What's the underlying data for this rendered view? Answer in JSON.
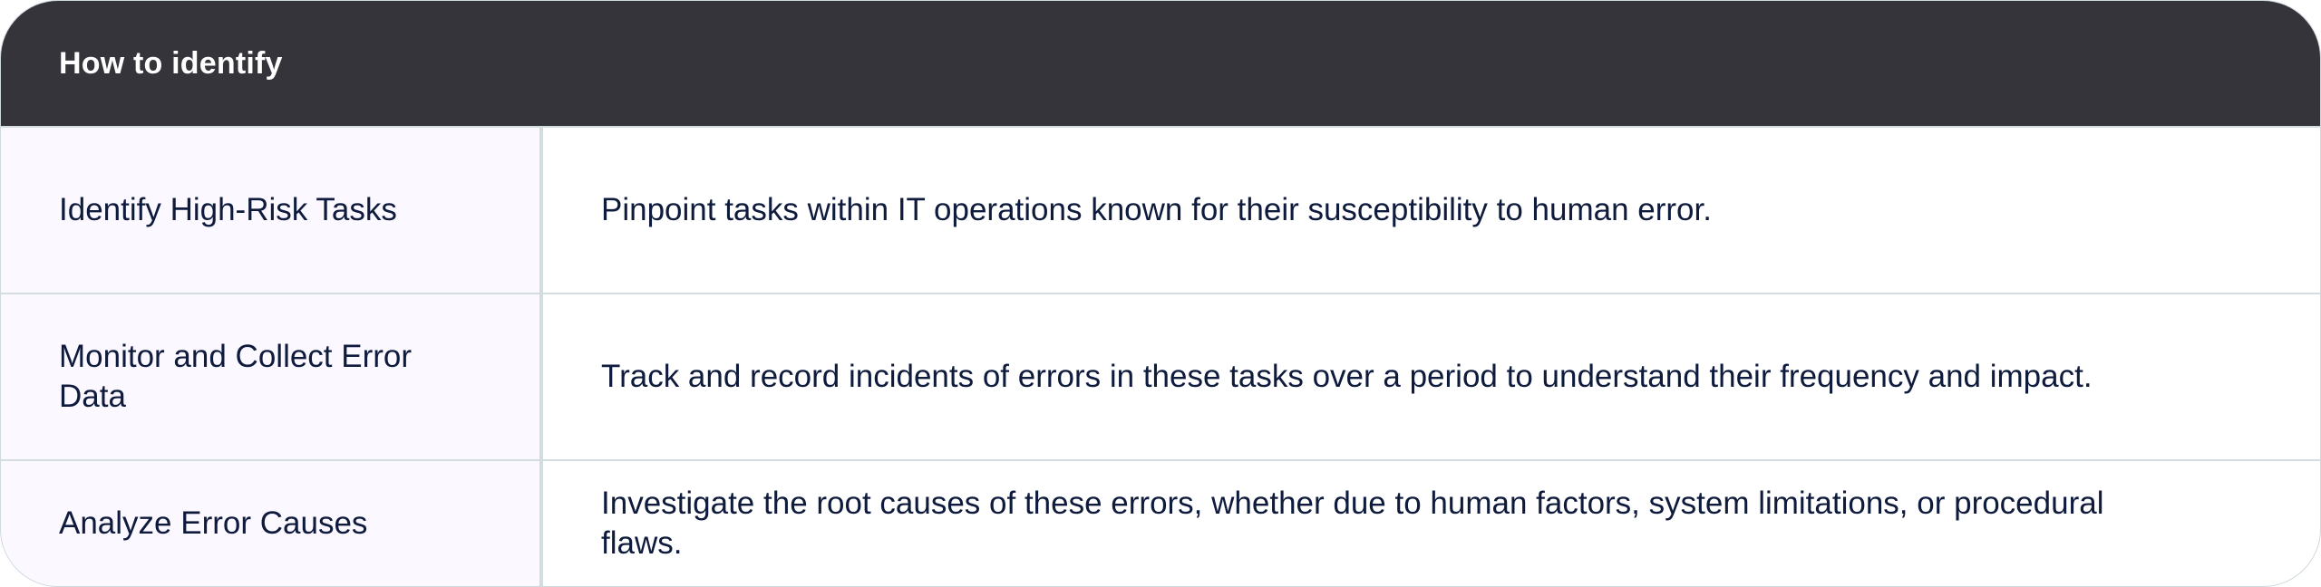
{
  "table": {
    "header": "How to identify",
    "rows": [
      {
        "label": "Identify High-Risk Tasks",
        "description": "Pinpoint tasks within IT operations known for their susceptibility to human error."
      },
      {
        "label": "Monitor and Collect Error Data",
        "description": "Track and record incidents of errors in these tasks over a period to understand their frequency and impact."
      },
      {
        "label": "Analyze Error Causes",
        "description": "Investigate the root causes of these errors, whether due to human factors, system limitations, or procedural flaws."
      }
    ]
  }
}
